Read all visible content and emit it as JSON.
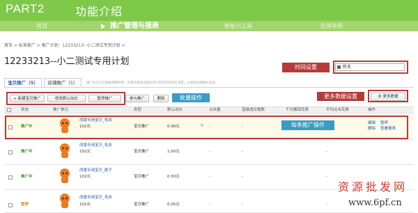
{
  "header": {
    "part": "PART2",
    "title": "功能介绍"
  },
  "nav": {
    "items": [
      {
        "label": "首页"
      },
      {
        "label": "推广管理与报表"
      },
      {
        "label": "智能小工具"
      },
      {
        "label": "应用举例"
      }
    ]
  },
  "breadcrumb": "首页  >  标准推广  >  推广计划：12233213--小二测试专用计划 >",
  "page_title": "12233213--小二测试专用计划",
  "annotations": {
    "time_setting": "时间设置",
    "batch_ops": "批量操作",
    "more_data_settings": "更多数据设置",
    "per_item_ops": "每条推广操作"
  },
  "date_select": {
    "value": "昨天"
  },
  "tabs": [
    {
      "label": "宝贝推广（5）"
    },
    {
      "label": "店铺推广（1）"
    }
  ],
  "tab_note": "推广的宝贝可根据预算控制，可最佳管理主推的宝贝获得足够多的流量，以便双击精确化投放。",
  "toolbar": {
    "new": "+ 新建宝贝推广",
    "modify_bid": "修改默认出价",
    "pause": "暂停推广",
    "join": "参与推广",
    "delete": "删除",
    "more_data": "更多数据"
  },
  "table": {
    "headers": [
      "状态",
      "推广单元",
      "类型",
      "默认出价",
      "点击量",
      "直接成交笔数",
      "千次展现花费",
      "平均点击花费",
      "操作"
    ],
    "rows": [
      {
        "status": "推广中",
        "title": "改版专用宝贝_毛衣",
        "price": "102元",
        "type": "宝贝推广",
        "bid": "0.90元",
        "clicks": "-",
        "deals": "-",
        "cpm": "",
        "cpc": "-",
        "op1": "编辑",
        "op2": "暂停",
        "op3": "删除",
        "op4": "查看报表"
      },
      {
        "status": "推广中",
        "title": "改版专用宝贝_毛衣",
        "price": "102元",
        "type": "宝贝推广",
        "bid": "1.00元",
        "clicks": "-",
        "deals": "-",
        "cpm": "",
        "cpc": "-",
        "op1": "",
        "op2": "",
        "op3": "",
        "op4": ""
      },
      {
        "status": "推广中",
        "title": "改版专用宝贝_裤子",
        "price": "102元",
        "type": "宝贝推广",
        "bid": "0.50元",
        "clicks": "-",
        "deals": "-",
        "cpm": "",
        "cpc": "-",
        "op1": "",
        "op2": "",
        "op3": "",
        "op4": ""
      },
      {
        "status": "暂停",
        "title": "改版专用宝贝_毛衣",
        "price": "102元",
        "type": "宝贝推广",
        "bid": "0.05元",
        "clicks": "-",
        "deals": "-",
        "cpm": "",
        "cpc": "-",
        "op1": "",
        "op2": "",
        "op3": "",
        "op4": ""
      }
    ]
  },
  "watermark": {
    "cn": "资源批发网",
    "url": "www.6pf.cn"
  },
  "colors": {
    "header_green": "#7ec84a",
    "nav_green": "#a3d56e",
    "annotation_red": "#b53a3a",
    "annotation_blue": "#3b9bc4",
    "status_green": "#3a9a2a",
    "status_pause": "#d88a10"
  }
}
